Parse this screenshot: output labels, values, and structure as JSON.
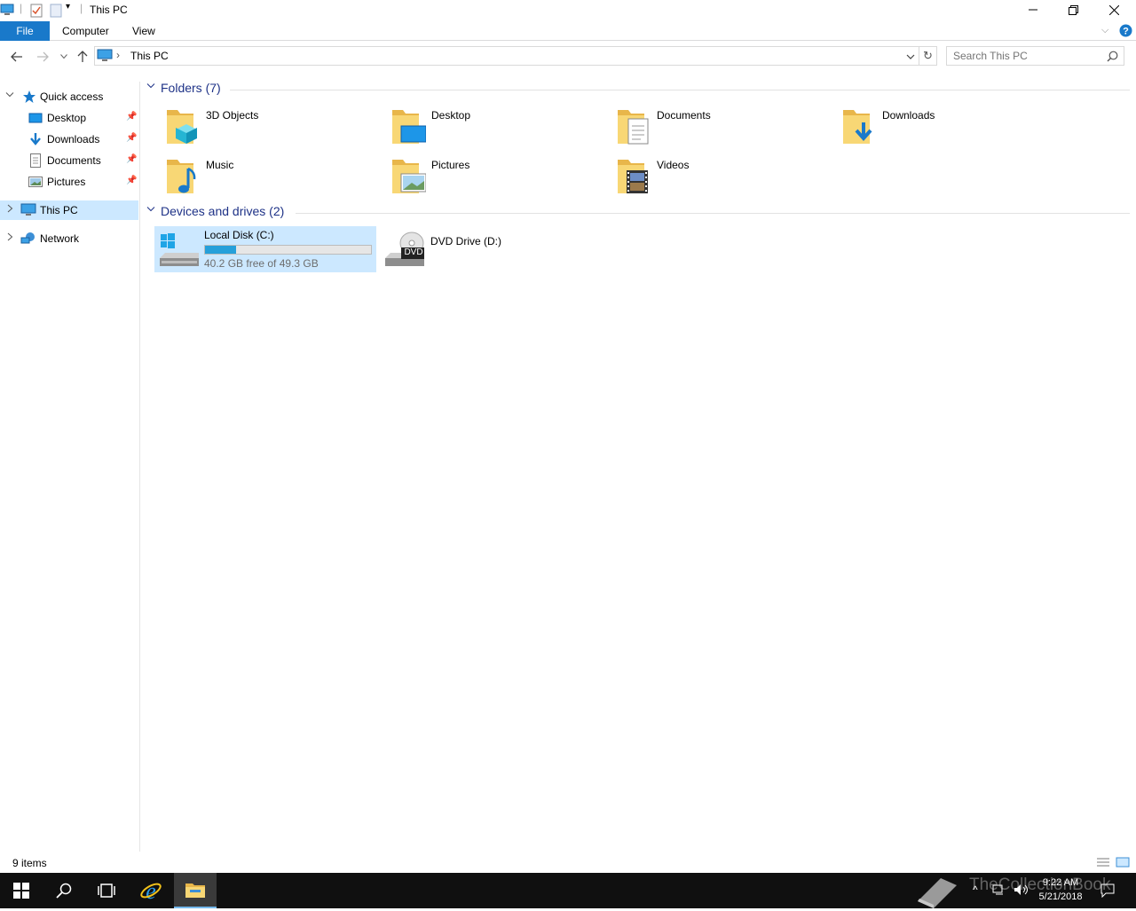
{
  "window": {
    "title": "This PC",
    "controls": [
      "minimize",
      "restore",
      "close"
    ]
  },
  "ribbon": {
    "tabs": [
      {
        "label": "File",
        "active": true
      },
      {
        "label": "Computer"
      },
      {
        "label": "View"
      }
    ]
  },
  "address": {
    "path": "This PC",
    "separator": "›"
  },
  "search": {
    "placeholder": "Search This PC"
  },
  "navpane": {
    "quick_access": "Quick access",
    "pinned": [
      "Desktop",
      "Downloads",
      "Documents",
      "Pictures"
    ],
    "this_pc": "This PC",
    "network": "Network"
  },
  "folders": {
    "header": "Folders (7)",
    "items": [
      "3D Objects",
      "Desktop",
      "Documents",
      "Downloads",
      "Music",
      "Pictures",
      "Videos"
    ]
  },
  "devices": {
    "header": "Devices and drives (2)",
    "local_disk": {
      "name": "Local Disk (C:)",
      "free_text": "40.2 GB free of 49.3 GB",
      "used_fraction": 0.185
    },
    "dvd": {
      "name": "DVD Drive (D:)",
      "badge": "DVD"
    }
  },
  "status": {
    "items": "9 items"
  },
  "taskbar": {
    "time": "9:22 AM",
    "date": "5/21/2018",
    "watermark": "TheCollectionBook"
  },
  "colors": {
    "accent": "#1979ca",
    "selection": "#cce8ff",
    "group_header": "#1e3287",
    "drive_bar": "#26a0da",
    "folder_yellow": "#f8d775"
  }
}
